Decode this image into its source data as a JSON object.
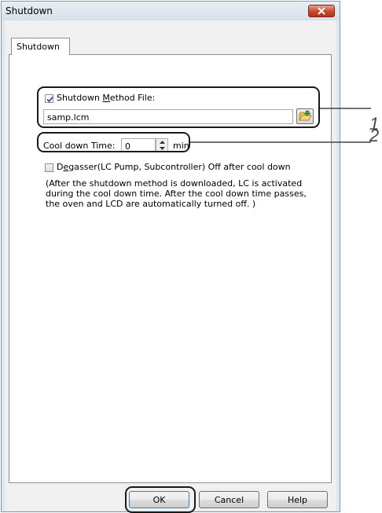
{
  "window": {
    "title": "Shutdown",
    "close_icon": "close-icon"
  },
  "tabs": [
    {
      "label": "Shutdown",
      "selected": true
    }
  ],
  "method_file": {
    "checkbox_label_pre": "Shutdown ",
    "checkbox_label_accel": "M",
    "checkbox_label_post": "ethod File:",
    "checked": true,
    "value": "samp.lcm",
    "browse_icon": "folder-open-icon"
  },
  "cool_down": {
    "label": "Cool down Time:",
    "value": "0",
    "unit": "min"
  },
  "degasser": {
    "label_pre": "D",
    "label_accel": "e",
    "label_post": "gasser(LC Pump, Subcontroller) Off after cool down",
    "checked": false
  },
  "note": {
    "lines": [
      "(After the shutdown method is downloaded, LC is activated",
      "during the cool down time. After the cool down time passes,",
      "the oven and LCD are automatically turned off. )"
    ]
  },
  "buttons": {
    "ok": "OK",
    "cancel": "Cancel",
    "help": "Help"
  },
  "callouts": {
    "one": "1",
    "two": "2"
  },
  "colors": {
    "window_frame": "#dfe6ee",
    "close_button": "#c8472e",
    "callout_line": "#1a1a1a"
  }
}
